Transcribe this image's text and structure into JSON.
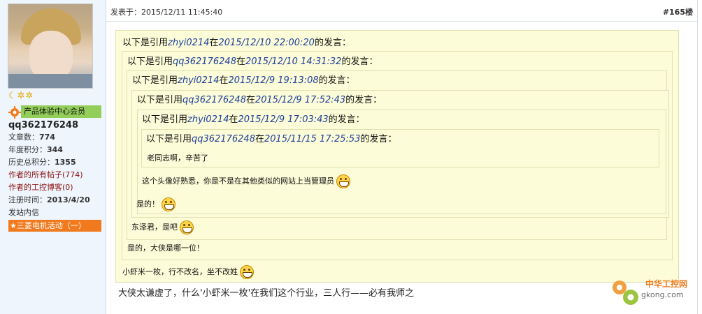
{
  "user": {
    "stars": "☾✲✲",
    "rank": "产品体验中心会员",
    "name": "qq362176248",
    "stats": [
      {
        "label": "文章数：",
        "value": "774"
      },
      {
        "label": "年度积分：",
        "value": "344"
      },
      {
        "label": "历史总积分：",
        "value": "1355"
      }
    ],
    "all_posts_link": "作者的所有帖子(774)",
    "blog_link": "作者的工控博客(0)",
    "reg_label": "注册时间：",
    "reg_value": "2013/4/20",
    "message_link": "发站内信",
    "activity_link": "三菱电机活动（一）"
  },
  "post": {
    "time": "发表于：2015/12/11 11:45:40",
    "floor": "#165楼",
    "quotes": [
      {
        "pre": "以下是引用",
        "user": "zhyi0214",
        "mid": "在",
        "time": "2015/12/10 22:00:20",
        "post": "的发言："
      },
      {
        "pre": "以下是引用",
        "user": "qq362176248",
        "mid": "在",
        "time": "2015/12/10 14:31:32",
        "post": "的发言："
      },
      {
        "pre": "以下是引用",
        "user": "zhyi0214",
        "mid": "在",
        "time": "2015/12/9 19:13:08",
        "post": "的发言："
      },
      {
        "pre": "以下是引用",
        "user": "qq362176248",
        "mid": "在",
        "time": "2015/12/9 17:52:43",
        "post": "的发言："
      },
      {
        "pre": "以下是引用",
        "user": "zhyi0214",
        "mid": "在",
        "time": "2015/12/9 17:03:43",
        "post": "的发言："
      },
      {
        "pre": "以下是引用",
        "user": "qq362176248",
        "mid": "在",
        "time": "2015/11/15 17:25:53",
        "post": "的发言："
      }
    ],
    "replies": [
      "老同志啊，辛苦了",
      "这个头像好熟悉，你是不是在其他类似的网站上当管理员",
      "是的！",
      "东泽君，是吧",
      "是的，大侠是哪一位！",
      "小虾米一枚，行不改名，坐不改姓"
    ],
    "body": "大侠太谦虚了，什么'小虾米一枚'在我们这个行业，三人行——必有我师之"
  },
  "watermark": {
    "name": "中华工控网",
    "domain": "gkong.com"
  }
}
